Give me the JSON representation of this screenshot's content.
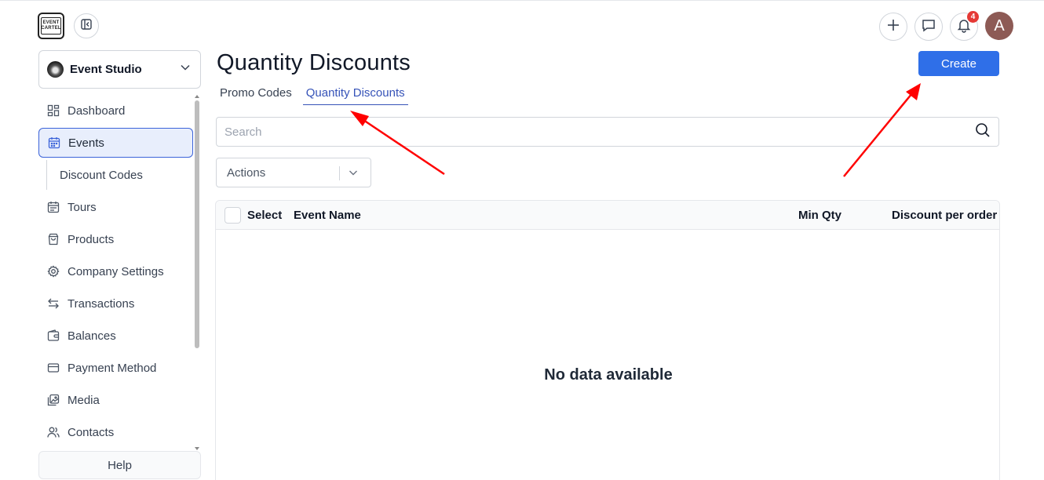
{
  "header": {
    "logo_text": [
      "EVENT",
      "CARTEL"
    ],
    "notification_count": "4",
    "avatar_letter": "A"
  },
  "sidebar": {
    "studio_name": "Event Studio",
    "items": [
      {
        "label": "Dashboard",
        "icon": "dashboard-icon"
      },
      {
        "label": "Events",
        "icon": "calendar-icon",
        "active": true
      },
      {
        "label": "Discount Codes",
        "sub": true
      },
      {
        "label": "Tours",
        "icon": "calendar-list-icon"
      },
      {
        "label": "Products",
        "icon": "bag-icon"
      },
      {
        "label": "Company Settings",
        "icon": "gear-icon"
      },
      {
        "label": "Transactions",
        "icon": "swap-icon"
      },
      {
        "label": "Balances",
        "icon": "wallet-icon"
      },
      {
        "label": "Payment Method",
        "icon": "card-icon"
      },
      {
        "label": "Media",
        "icon": "images-icon"
      },
      {
        "label": "Contacts",
        "icon": "users-icon"
      }
    ],
    "help_label": "Help"
  },
  "main": {
    "title": "Quantity Discounts",
    "create_label": "Create",
    "tabs": [
      {
        "label": "Promo Codes",
        "active": false
      },
      {
        "label": "Quantity Discounts",
        "active": true
      }
    ],
    "search_placeholder": "Search",
    "actions_label": "Actions",
    "table": {
      "columns": [
        "Select",
        "Event Name",
        "Min Qty",
        "Discount per order"
      ],
      "empty_text": "No data available"
    }
  },
  "colors": {
    "accent": "#2f6fe8",
    "active_nav_bg": "#e8eefc",
    "annotation_arrow": "#ff0000"
  }
}
